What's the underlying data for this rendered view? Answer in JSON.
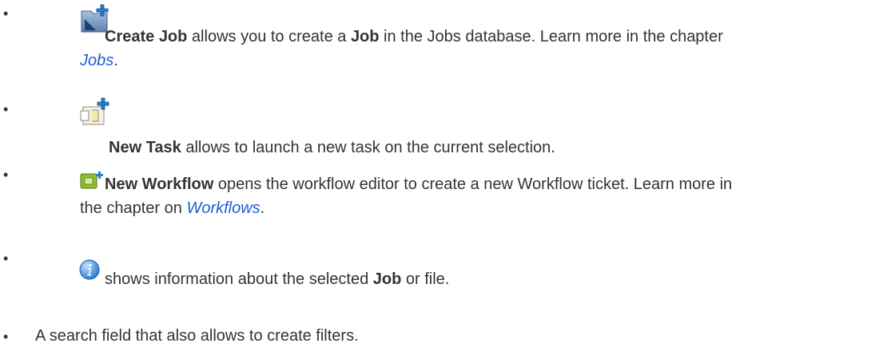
{
  "items": [
    {
      "icon": "create-job-icon",
      "line1": [
        "Create Job",
        " allows you to create a ",
        "Job",
        " in the Jobs database. Learn more in the chapter"
      ],
      "line2": [
        "Jobs",
        "."
      ]
    },
    {
      "icon": "new-task-icon",
      "line1": [
        "New Task",
        " allows to launch a new task on the current selection."
      ]
    },
    {
      "icon": "new-workflow-icon",
      "line1": [
        "New Workflow",
        " opens the workflow editor to create a new Workflow ticket. Learn more in"
      ],
      "line2": [
        "the chapter on ",
        "Workflows",
        "."
      ]
    },
    {
      "icon": "info-icon",
      "line1": [
        "shows information about the selected ",
        "Job",
        " or file."
      ]
    },
    {
      "line1": [
        "A search field that also allows to create filters."
      ]
    }
  ],
  "bullet": "•",
  "colors": {
    "link": "#1a5fd6",
    "text": "#333333"
  }
}
